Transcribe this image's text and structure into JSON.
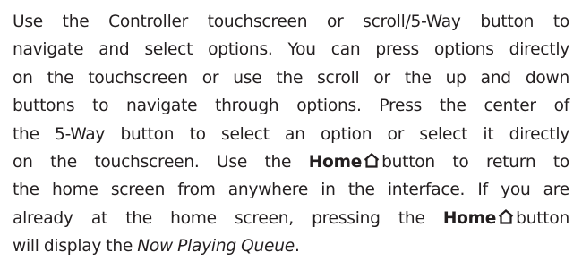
{
  "paragraph": {
    "line1": "Use the Controller touchscreen or scroll/5-Way button to",
    "line2": "navigate and select options. You can press options directly",
    "line3": "on the touchscreen or use the scroll or the up and down",
    "line4": "buttons to navigate through options. Press the center of",
    "line5": "the 5-Way button to select an option or select it directly",
    "line6_pre": "on the touchscreen. Use the",
    "line6_home": "Home",
    "line6_post": "button to return to",
    "line7": "the home screen from anywhere in the interface. If you are",
    "line8_pre": "already at the home screen, pressing the",
    "line8_home": "Home",
    "line8_post": "button",
    "line9_pre": "will display the",
    "line9_link": "Now Playing Queue",
    "line9_post": "."
  },
  "icons": {
    "home": "home-icon"
  }
}
